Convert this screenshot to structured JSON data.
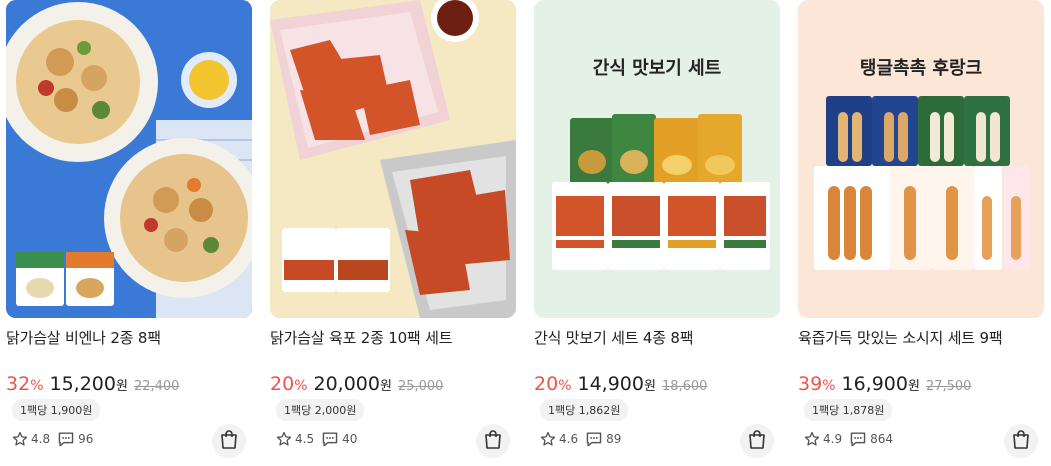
{
  "products": [
    {
      "name": "닭가슴살 비엔나 2종 8팩",
      "discount": "32",
      "discount_unit": "%",
      "sale_price": "15,200",
      "currency": "원",
      "original_price": "22,400",
      "unit_price": "1팩당 1,900원",
      "rating": "4.8",
      "reviews": "96",
      "image_title": ""
    },
    {
      "name": "닭가슴살 육포 2종 10팩 세트",
      "discount": "20",
      "discount_unit": "%",
      "sale_price": "20,000",
      "currency": "원",
      "original_price": "25,000",
      "unit_price": "1팩당 2,000원",
      "rating": "4.5",
      "reviews": "40",
      "image_title": ""
    },
    {
      "name": "간식 맛보기 세트 4종 8팩",
      "discount": "20",
      "discount_unit": "%",
      "sale_price": "14,900",
      "currency": "원",
      "original_price": "18,600",
      "unit_price": "1팩당 1,862원",
      "rating": "4.6",
      "reviews": "89",
      "image_title": "간식 맛보기 세트"
    },
    {
      "name": "육즙가득 맛있는 소시지 세트 9팩",
      "discount": "39",
      "discount_unit": "%",
      "sale_price": "16,900",
      "currency": "원",
      "original_price": "27,500",
      "unit_price": "1팩당 1,878원",
      "rating": "4.9",
      "reviews": "864",
      "image_title": "탱글촉촉 후랑크"
    }
  ],
  "colors": {
    "discount": "#f0534b",
    "card1_bg": "#3f7cd8",
    "card2_bg": "#f4e9c2",
    "card3_bg": "#e3f1e6",
    "card4_bg": "#fbe6d8"
  },
  "icons": [
    "star-icon",
    "comment-icon",
    "shopping-bag-icon"
  ]
}
